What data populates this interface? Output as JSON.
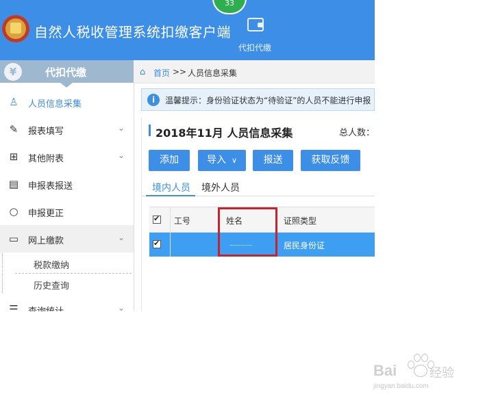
{
  "header": {
    "app_title": "自然人税收管理系统扣缴客户端",
    "badge_count": "33",
    "module_label": "代扣代缴",
    "brand_color": "#3c8ee6"
  },
  "sidebar": {
    "title": "代扣代缴",
    "items": [
      {
        "label": "人员信息采集",
        "icon": "person-icon",
        "active": true
      },
      {
        "label": "报表填写",
        "icon": "edit-icon",
        "expandable": true
      },
      {
        "label": "其他附表",
        "icon": "grid-icon",
        "expandable": true
      },
      {
        "label": "申报表报送",
        "icon": "document-icon"
      },
      {
        "label": "申报更正",
        "icon": "search-icon"
      },
      {
        "label": "网上缴款",
        "icon": "folder-icon",
        "expandable": true,
        "open": true
      },
      {
        "label": "查询统计",
        "icon": "query-icon",
        "expandable": true
      }
    ],
    "sub_items": [
      "税款缴纳",
      "历史查询"
    ]
  },
  "breadcrumb": {
    "home": "首页",
    "separator": ">>",
    "current": "人员信息采集"
  },
  "tip": {
    "text": "温馨提示：身份验证状态为“待验证”的人员不能进行申报"
  },
  "main": {
    "title": "2018年11月  人员信息采集",
    "total_label": "总人数：",
    "buttons": {
      "add": "添加",
      "import": "导入",
      "submit": "报送",
      "feedback": "获取反馈"
    },
    "tabs": [
      "境内人员",
      "境外人员"
    ],
    "table": {
      "columns": [
        "工号",
        "姓名",
        "证照类型"
      ],
      "rows": [
        {
          "id": "",
          "name": "",
          "cert_type": "居民身份证",
          "checked": true
        }
      ]
    }
  },
  "watermark": {
    "brand": "Bai",
    "brand2": "经验",
    "url": "jingyan.baidu.com"
  }
}
